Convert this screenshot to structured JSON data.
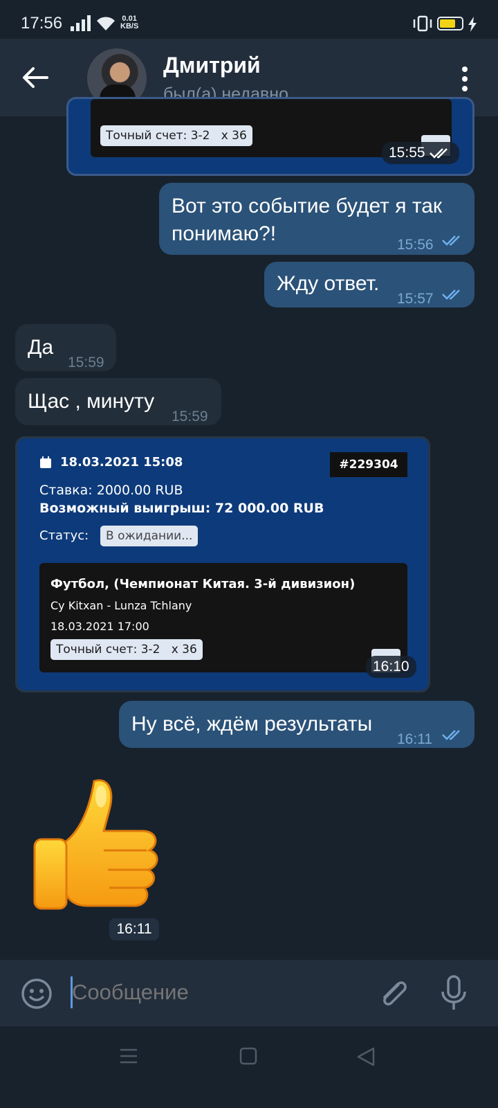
{
  "status_bar": {
    "time": "17:56",
    "speed_value": "0.01",
    "speed_unit": "KB/S"
  },
  "header": {
    "name": "Дмитрий",
    "status": "был(а) недавно"
  },
  "colors": {
    "out_bubble": "#2b5278",
    "in_bubble": "#222e3a",
    "header": "#232e3c",
    "background": "#18222d",
    "accent": "#5d9bde",
    "bet_card": "#0d3a7a"
  },
  "top_card": {
    "pill_score": "Точный счет: 3-2",
    "pill_odds": "x 36",
    "time": "15:55"
  },
  "messages": [
    {
      "dir": "out",
      "text_line1": "Вот это событие будет я так",
      "text_line2": "понимаю?!",
      "time": "15:56"
    },
    {
      "dir": "out",
      "text": "Жду ответ.",
      "time": "15:57"
    },
    {
      "dir": "in",
      "text": "Да",
      "time": "15:59"
    },
    {
      "dir": "in",
      "text": "Щас , минуту",
      "time": "15:59"
    }
  ],
  "bet_card": {
    "date": "18.03.2021 15:08",
    "ticket": "#229304",
    "stake": "Ставка: 2000.00 RUB",
    "win": "Возможный выигрыш: 72 000.00 RUB",
    "status_label": "Статус:",
    "status_value": "В ожидании...",
    "event_title": "Футбол, (Чемпионат Китая. 3-й дивизион)",
    "teams": "Cy Kitxan - Lunza Tchlany",
    "event_date": "18.03.2021 17:00",
    "pill_score": "Точный счет: 3-2",
    "pill_odds": "x 36",
    "time": "16:10"
  },
  "last_message": {
    "text": "Ну всё, ждём результаты",
    "time": "16:11"
  },
  "sticker": {
    "icon": "thumbs-up",
    "time": "16:11"
  },
  "input": {
    "placeholder": "Сообщение"
  }
}
